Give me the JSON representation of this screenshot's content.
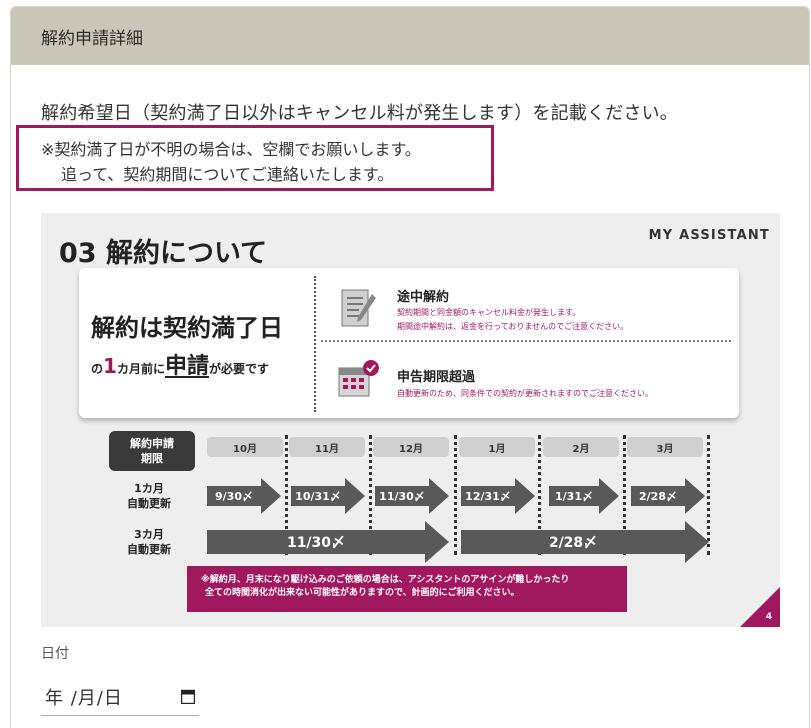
{
  "header": {
    "title": "解約申請詳細"
  },
  "form": {
    "description": "解約希望日（契約満了日以外はキャンセル料が発生します）を記載ください。",
    "notice_line1": "※契約満了日が不明の場合は、空欄でお願いします。",
    "notice_line2": "追って、契約期間についてご連絡いたします。",
    "date_label": "日付",
    "date_placeholder": "年 /月/日"
  },
  "slide": {
    "title": "03 解約について",
    "brand": "MY ASSISTANT",
    "main_text": "解約は契約満了日",
    "sub_prefix": "の",
    "sub_one": "1",
    "sub_month": "カ月前に",
    "sub_apply": "申請",
    "sub_suffix": "が必要です",
    "item1_title": "途中解約",
    "item1_line1": "契約期間と同金額のキャンセル料金が発生します。",
    "item1_line2": "期間途中解約は、返金を行っておりませんのでご注意ください。",
    "item2_title": "申告期限超過",
    "item2_line1": "自動更新のため、同条件での契約が更新されますのでご注意ください。",
    "deadline_line1": "解約申請",
    "deadline_line2": "期限",
    "months": [
      "10月",
      "11月",
      "12月",
      "1月",
      "2月",
      "3月"
    ],
    "row1_line1": "1カ月",
    "row1_line2": "自動更新",
    "row1_dates": [
      "9/30〆",
      "10/31〆",
      "11/30〆",
      "12/31〆",
      "1/31〆",
      "2/28〆"
    ],
    "row2_line1": "3カ月",
    "row2_line2": "自動更新",
    "row2_dates": [
      "11/30〆",
      "2/28〆"
    ],
    "footnote_line1": "※解約月、月末になり駆け込みのご依頼の場合は、アシスタントのアサインが難しかったり",
    "footnote_line2": "全ての時間消化が出来ない可能性がありますので、計画的にご利用ください。",
    "page_number": "4",
    "accent_color": "#a0185e"
  }
}
